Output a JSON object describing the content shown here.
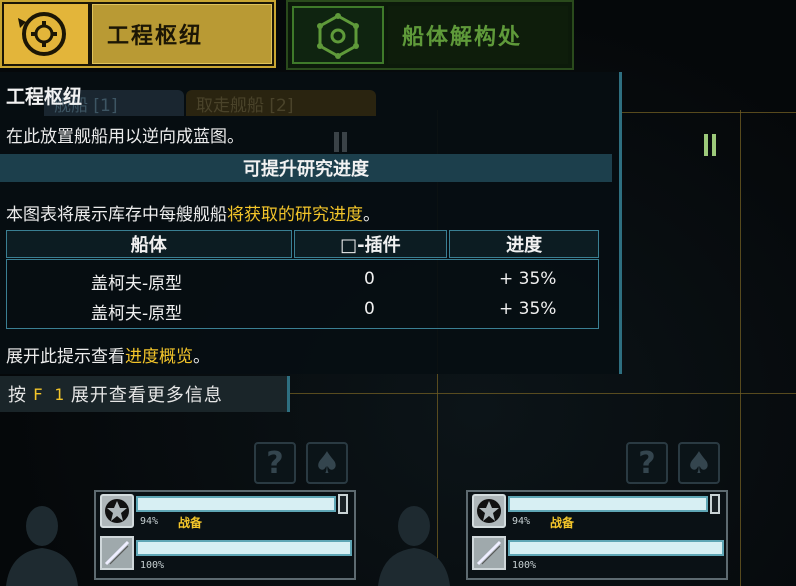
{
  "tabs": {
    "active_label": "工程枢纽",
    "inactive_label": "船体解构处"
  },
  "tooltip": {
    "title": "工程枢纽",
    "ghost_tab_1": "舰船 [1]",
    "ghost_tab_2": "取走舰船 [2]",
    "description": "在此放置舰船用以逆向成蓝图。",
    "section_header": "可提升研究进度",
    "chart_intro_prefix": "本图表将展示库存中每艘舰船",
    "chart_intro_highlight": "将获取的研究进度",
    "chart_intro_suffix": "。",
    "table": {
      "headers": [
        "船体",
        "□-插件",
        "进度"
      ],
      "rows": [
        {
          "hull": "盖柯夫-原型",
          "plugins": "0",
          "progress": "+ 35%"
        },
        {
          "hull": "盖柯夫-原型",
          "plugins": "0",
          "progress": "+ 35%"
        }
      ]
    },
    "footer_prefix": "展开此提示查看",
    "footer_highlight": "进度概览",
    "footer_suffix": "。"
  },
  "hint": {
    "prefix": "按",
    "key": "F 1",
    "suffix": "展开查看更多信息"
  },
  "slots": [
    {
      "readiness": "94%",
      "ready_label": "战备",
      "condition": "100%"
    },
    {
      "readiness": "94%",
      "ready_label": "战备",
      "condition": "100%"
    }
  ],
  "colors": {
    "accent_gold": "#e3b53a",
    "highlight_text": "#f3c52a",
    "panel_border": "#2e6f80",
    "inactive_green": "#5f9a3a"
  }
}
